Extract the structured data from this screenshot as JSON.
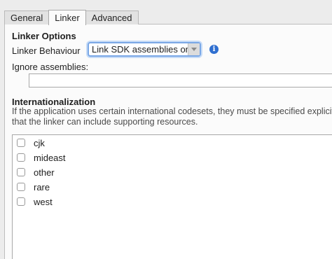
{
  "tabs": [
    {
      "label": "General"
    },
    {
      "label": "Linker"
    },
    {
      "label": "Advanced"
    }
  ],
  "active_tab": "Linker",
  "linker_options": {
    "title": "Linker Options",
    "behaviour_label": "Linker Behaviour",
    "behaviour_value": "Link SDK assemblies only",
    "info_icon": "i",
    "ignore_label": "Ignore assemblies:",
    "ignore_value": ""
  },
  "internationalization": {
    "title": "Internationalization",
    "description_line1": "If the application uses certain international codesets, they must be specified explicitly s",
    "description_line2": "that the linker can include supporting resources.",
    "items": [
      {
        "label": "cjk",
        "checked": false
      },
      {
        "label": "mideast",
        "checked": false
      },
      {
        "label": "other",
        "checked": false
      },
      {
        "label": "rare",
        "checked": false
      },
      {
        "label": "west",
        "checked": false
      }
    ]
  }
}
